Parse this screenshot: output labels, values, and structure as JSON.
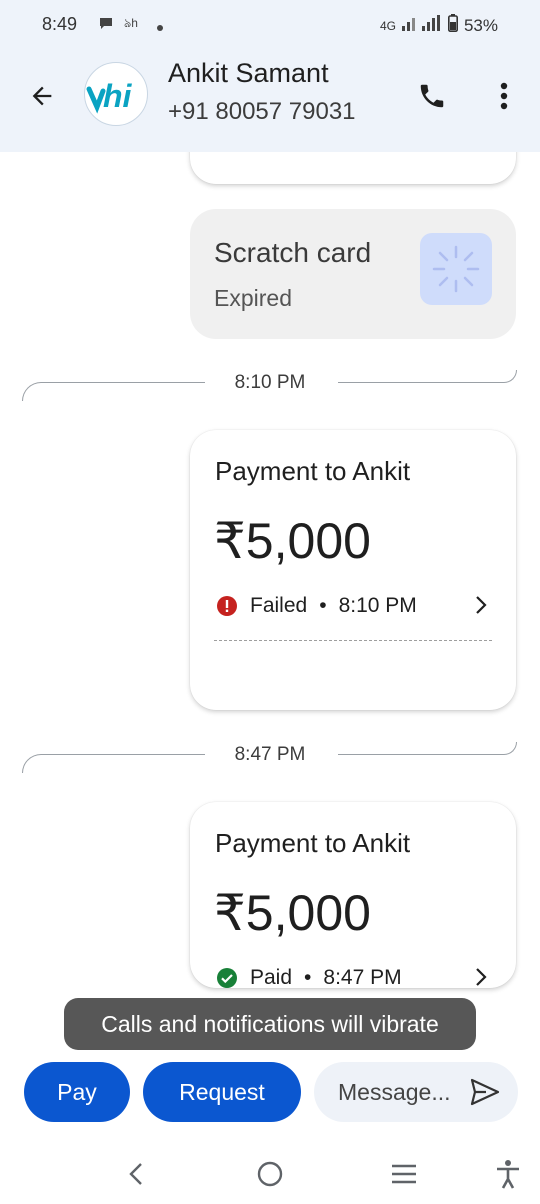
{
  "status_bar": {
    "time": "8:49",
    "network": "4G",
    "battery": "53%"
  },
  "header": {
    "contact_name": "Ankit Samant",
    "contact_phone": "+91 80057 79031",
    "avatar_text": "hi"
  },
  "chat": {
    "scratch_card": {
      "title": "Scratch card",
      "subtitle": "Expired"
    },
    "separators": [
      "8:10 PM",
      "8:47 PM"
    ],
    "payments": [
      {
        "title": "Payment to Ankit",
        "amount": "₹5,000",
        "status": "Failed",
        "time": "8:10 PM",
        "status_color": "#c5221f"
      },
      {
        "title": "Payment to Ankit",
        "amount": "₹5,000",
        "status": "Paid",
        "time": "8:47 PM",
        "status_color": "#188038"
      }
    ]
  },
  "toast": "Calls and notifications will vibrate",
  "composer": {
    "pay_label": "Pay",
    "request_label": "Request",
    "message_placeholder": "Message..."
  },
  "colors": {
    "accent": "#0b57d0",
    "header_bg": "#eef3fa"
  }
}
